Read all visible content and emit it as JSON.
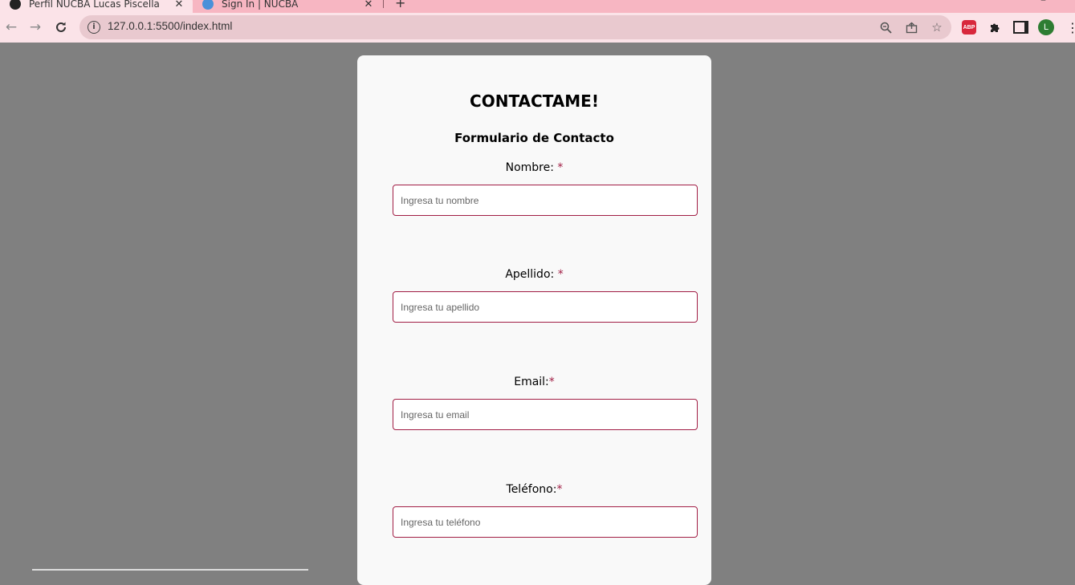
{
  "browser": {
    "tabs": [
      {
        "title": "Perfil NUCBA Lucas Piscella",
        "active": true
      },
      {
        "title": "Sign In | NUCBA",
        "active": false
      }
    ],
    "url": "127.0.0.1:5500/index.html",
    "profile_initial": "L",
    "extension_abp": "ABP"
  },
  "form": {
    "title": "CONTACTAME!",
    "subtitle": "Formulario de Contacto",
    "fields": [
      {
        "label": "Nombre:",
        "required_mark": "*",
        "placeholder": "Ingresa tu nombre"
      },
      {
        "label": "Apellido:",
        "required_mark": "*",
        "placeholder": "Ingresa tu apellido"
      },
      {
        "label": "Email:",
        "required_mark": "*",
        "placeholder": "Ingresa tu email"
      },
      {
        "label": "Teléfono:",
        "required_mark": "*",
        "placeholder": "Ingresa tu teléfono"
      }
    ]
  },
  "colors": {
    "accent": "#a11d44",
    "overlay": "#808080",
    "tabstrip": "#f7b6c2"
  }
}
